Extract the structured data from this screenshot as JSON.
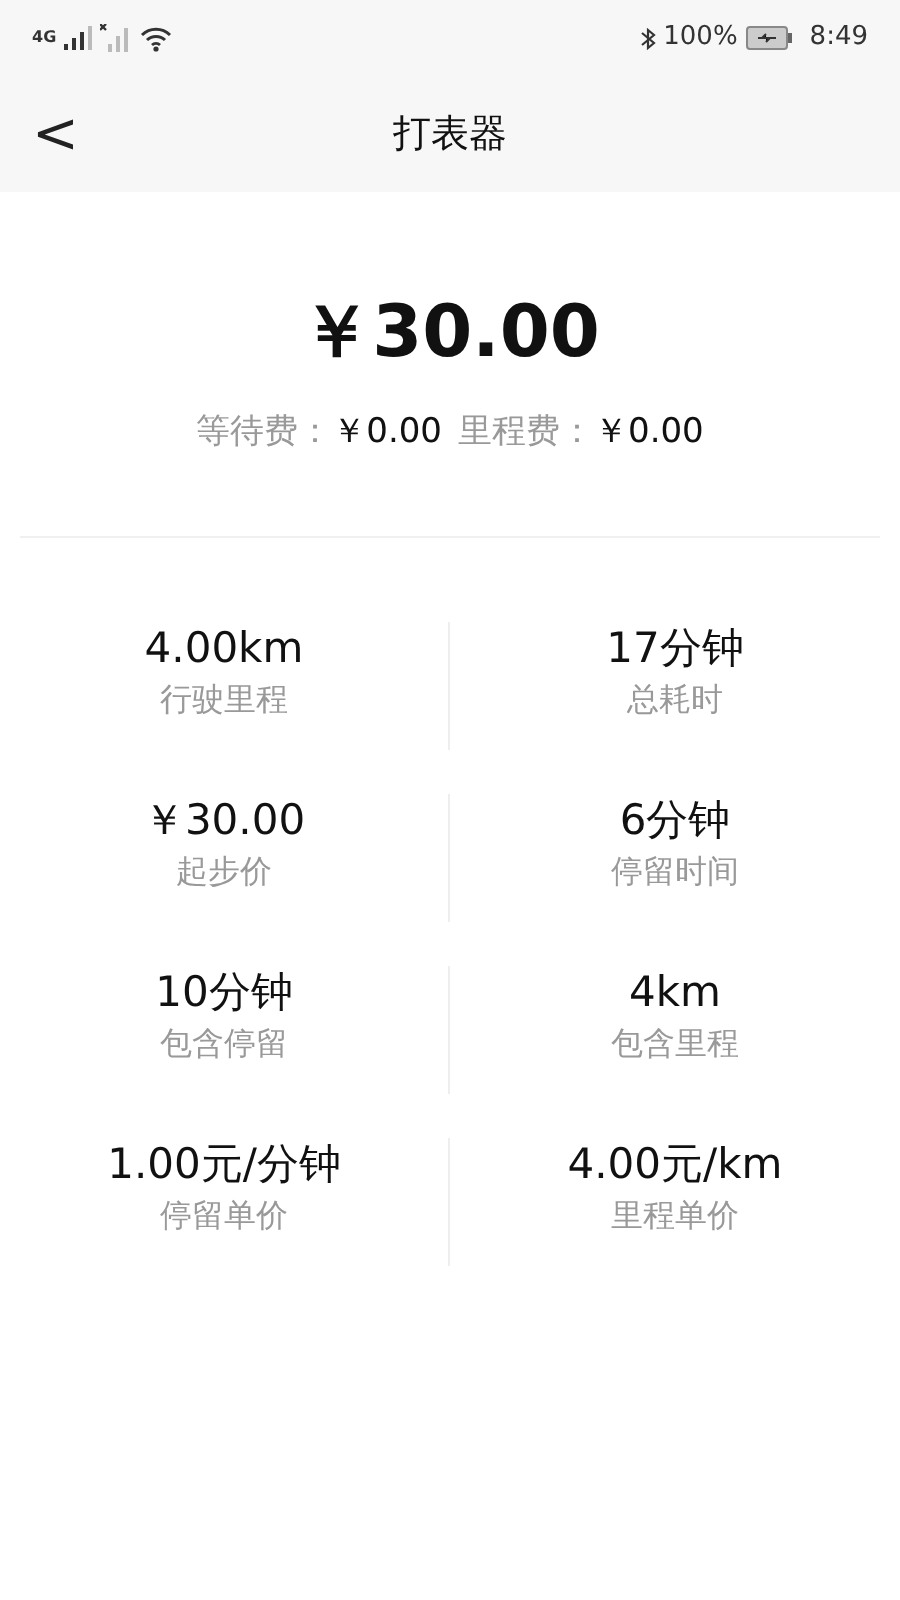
{
  "status_bar": {
    "network": "4G",
    "battery": "100%",
    "time": "8:49"
  },
  "header": {
    "back": "<",
    "title": "打表器"
  },
  "total": "￥30.00",
  "fees": [
    {
      "label": "等待费：",
      "value": "￥0.00"
    },
    {
      "label": "里程费：",
      "value": "￥0.00"
    }
  ],
  "stats": [
    {
      "value": "4.00km",
      "label": "行驶里程"
    },
    {
      "value": "17分钟",
      "label": "总耗时"
    },
    {
      "value": "￥30.00",
      "label": "起步价"
    },
    {
      "value": "6分钟",
      "label": "停留时间"
    },
    {
      "value": "10分钟",
      "label": "包含停留"
    },
    {
      "value": "4km",
      "label": "包含里程"
    },
    {
      "value": "1.00元/分钟",
      "label": "停留单价"
    },
    {
      "value": "4.00元/km",
      "label": "里程单价"
    }
  ]
}
